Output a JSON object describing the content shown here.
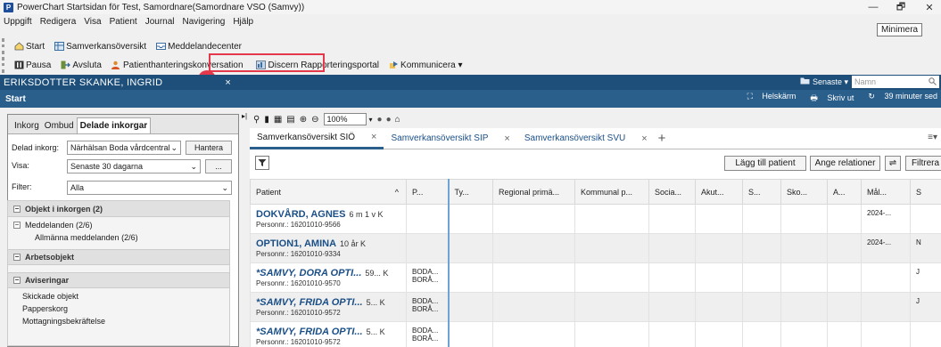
{
  "window": {
    "title": "PowerChart Startsidan för Test, Samordnare(Samordnare VSO (Samvy))",
    "minimize_tooltip": "Minimera",
    "controls": {
      "minimize": "—",
      "restore": "🗗",
      "close": "✕"
    }
  },
  "menu": [
    "Uppgift",
    "Redigera",
    "Visa",
    "Patient",
    "Journal",
    "Navigering",
    "Hjälp"
  ],
  "toolbar1": [
    {
      "label": "Start",
      "icon": "home-icon"
    },
    {
      "label": "Samverkansöversikt",
      "icon": "grid-icon"
    },
    {
      "label": "Meddelandecenter",
      "icon": "inbox-icon"
    }
  ],
  "toolbar2": [
    {
      "label": "Pausa",
      "icon": "pause-icon"
    },
    {
      "label": "Avsluta",
      "icon": "exit-icon"
    },
    {
      "label": "Patienthanteringskonversation",
      "icon": "person-icon"
    },
    {
      "label": "Discern Rapporteringsportal",
      "icon": "report-icon"
    },
    {
      "label": "Kommunicera ▾",
      "icon": "communicate-icon"
    }
  ],
  "callout": "1",
  "patient_bar": {
    "name": "ERIKSDOTTER SKANKE, INGRID",
    "close": "×",
    "recent": "Senaste ▾",
    "search_placeholder": "Namn"
  },
  "start_bar": {
    "title": "Start",
    "fullscreen": "Helskärm",
    "print": "Skriv ut",
    "updated": "39 minuter sed"
  },
  "left_panel": {
    "tabs": [
      "Inkorg",
      "Ombud",
      "Delade inkorgar"
    ],
    "shared_inbox_label": "Delad inkorg:",
    "shared_inbox_value": "Närhälsan Boda vårdcentral",
    "manage_button": "Hantera",
    "show_label": "Visa:",
    "show_value": "Senaste 30 dagarna",
    "more_button": "...",
    "filter_label": "Filter:",
    "filter_value": "Alla",
    "tree": {
      "inbox_header": "Objekt i inkorgen (2)",
      "messages": "Meddelanden (2/6)",
      "general_messages": "Allmänna meddelanden (2/6)",
      "work_header": "Arbetsobjekt",
      "notices_header": "Aviseringar",
      "sent": "Skickade objekt",
      "trash": "Papperskorg",
      "receipts": "Mottagningsbekräftelse"
    }
  },
  "main": {
    "zoom": "100%",
    "tabs": [
      {
        "label": "Samverkansöversikt SIÖ",
        "active": true
      },
      {
        "label": "Samverkansöversikt SIP",
        "active": false
      },
      {
        "label": "Samverkansöversikt SVU",
        "active": false
      }
    ],
    "tab_close": "×",
    "tab_add": "+",
    "menu_icon": "≡▾",
    "add_patient": "Lägg till patient",
    "set_relations": "Ange relationer",
    "filter_btn": "Filtrera",
    "columns": [
      "Patient",
      "P...",
      "Ty...",
      "Regional primä...",
      "Kommunal p...",
      "Socia...",
      "Akut...",
      "S...",
      "Sko...",
      "A...",
      "Mål...",
      "S"
    ],
    "sort_indicator": "^",
    "rows": [
      {
        "name": "DOKVÅRD, AGNES",
        "meta": "6 m 1 v  K",
        "pnr": "Personnr.: 16201010-9566",
        "italic": false,
        "p1": "",
        "p2": "",
        "mal": "2024-...",
        "last": ""
      },
      {
        "name": "OPTION1, AMINA",
        "meta": "10 år  K",
        "pnr": "Personnr.: 16201010-9334",
        "italic": false,
        "p1": "",
        "p2": "",
        "mal": "2024-...",
        "last": "N"
      },
      {
        "name": "*SAMVY, DORA OPTI...",
        "meta": "59...  K",
        "pnr": "Personnr.: 16201010-9570",
        "italic": true,
        "p1": "BODA...",
        "p2": "BORÅ...",
        "mal": "",
        "last": "J"
      },
      {
        "name": "*SAMVY, FRIDA OPTI...",
        "meta": "5...  K",
        "pnr": "Personnr.: 16201010-9572",
        "italic": true,
        "p1": "BODA...",
        "p2": "BORÅ...",
        "mal": "",
        "last": "J"
      },
      {
        "name": "*SAMVY, FRIDA OPTI...",
        "meta": "5...  K",
        "pnr": "Personnr.: 16201010-9572",
        "italic": true,
        "p1": "BODA...",
        "p2": "BORÅ...",
        "mal": "",
        "last": ""
      }
    ]
  }
}
